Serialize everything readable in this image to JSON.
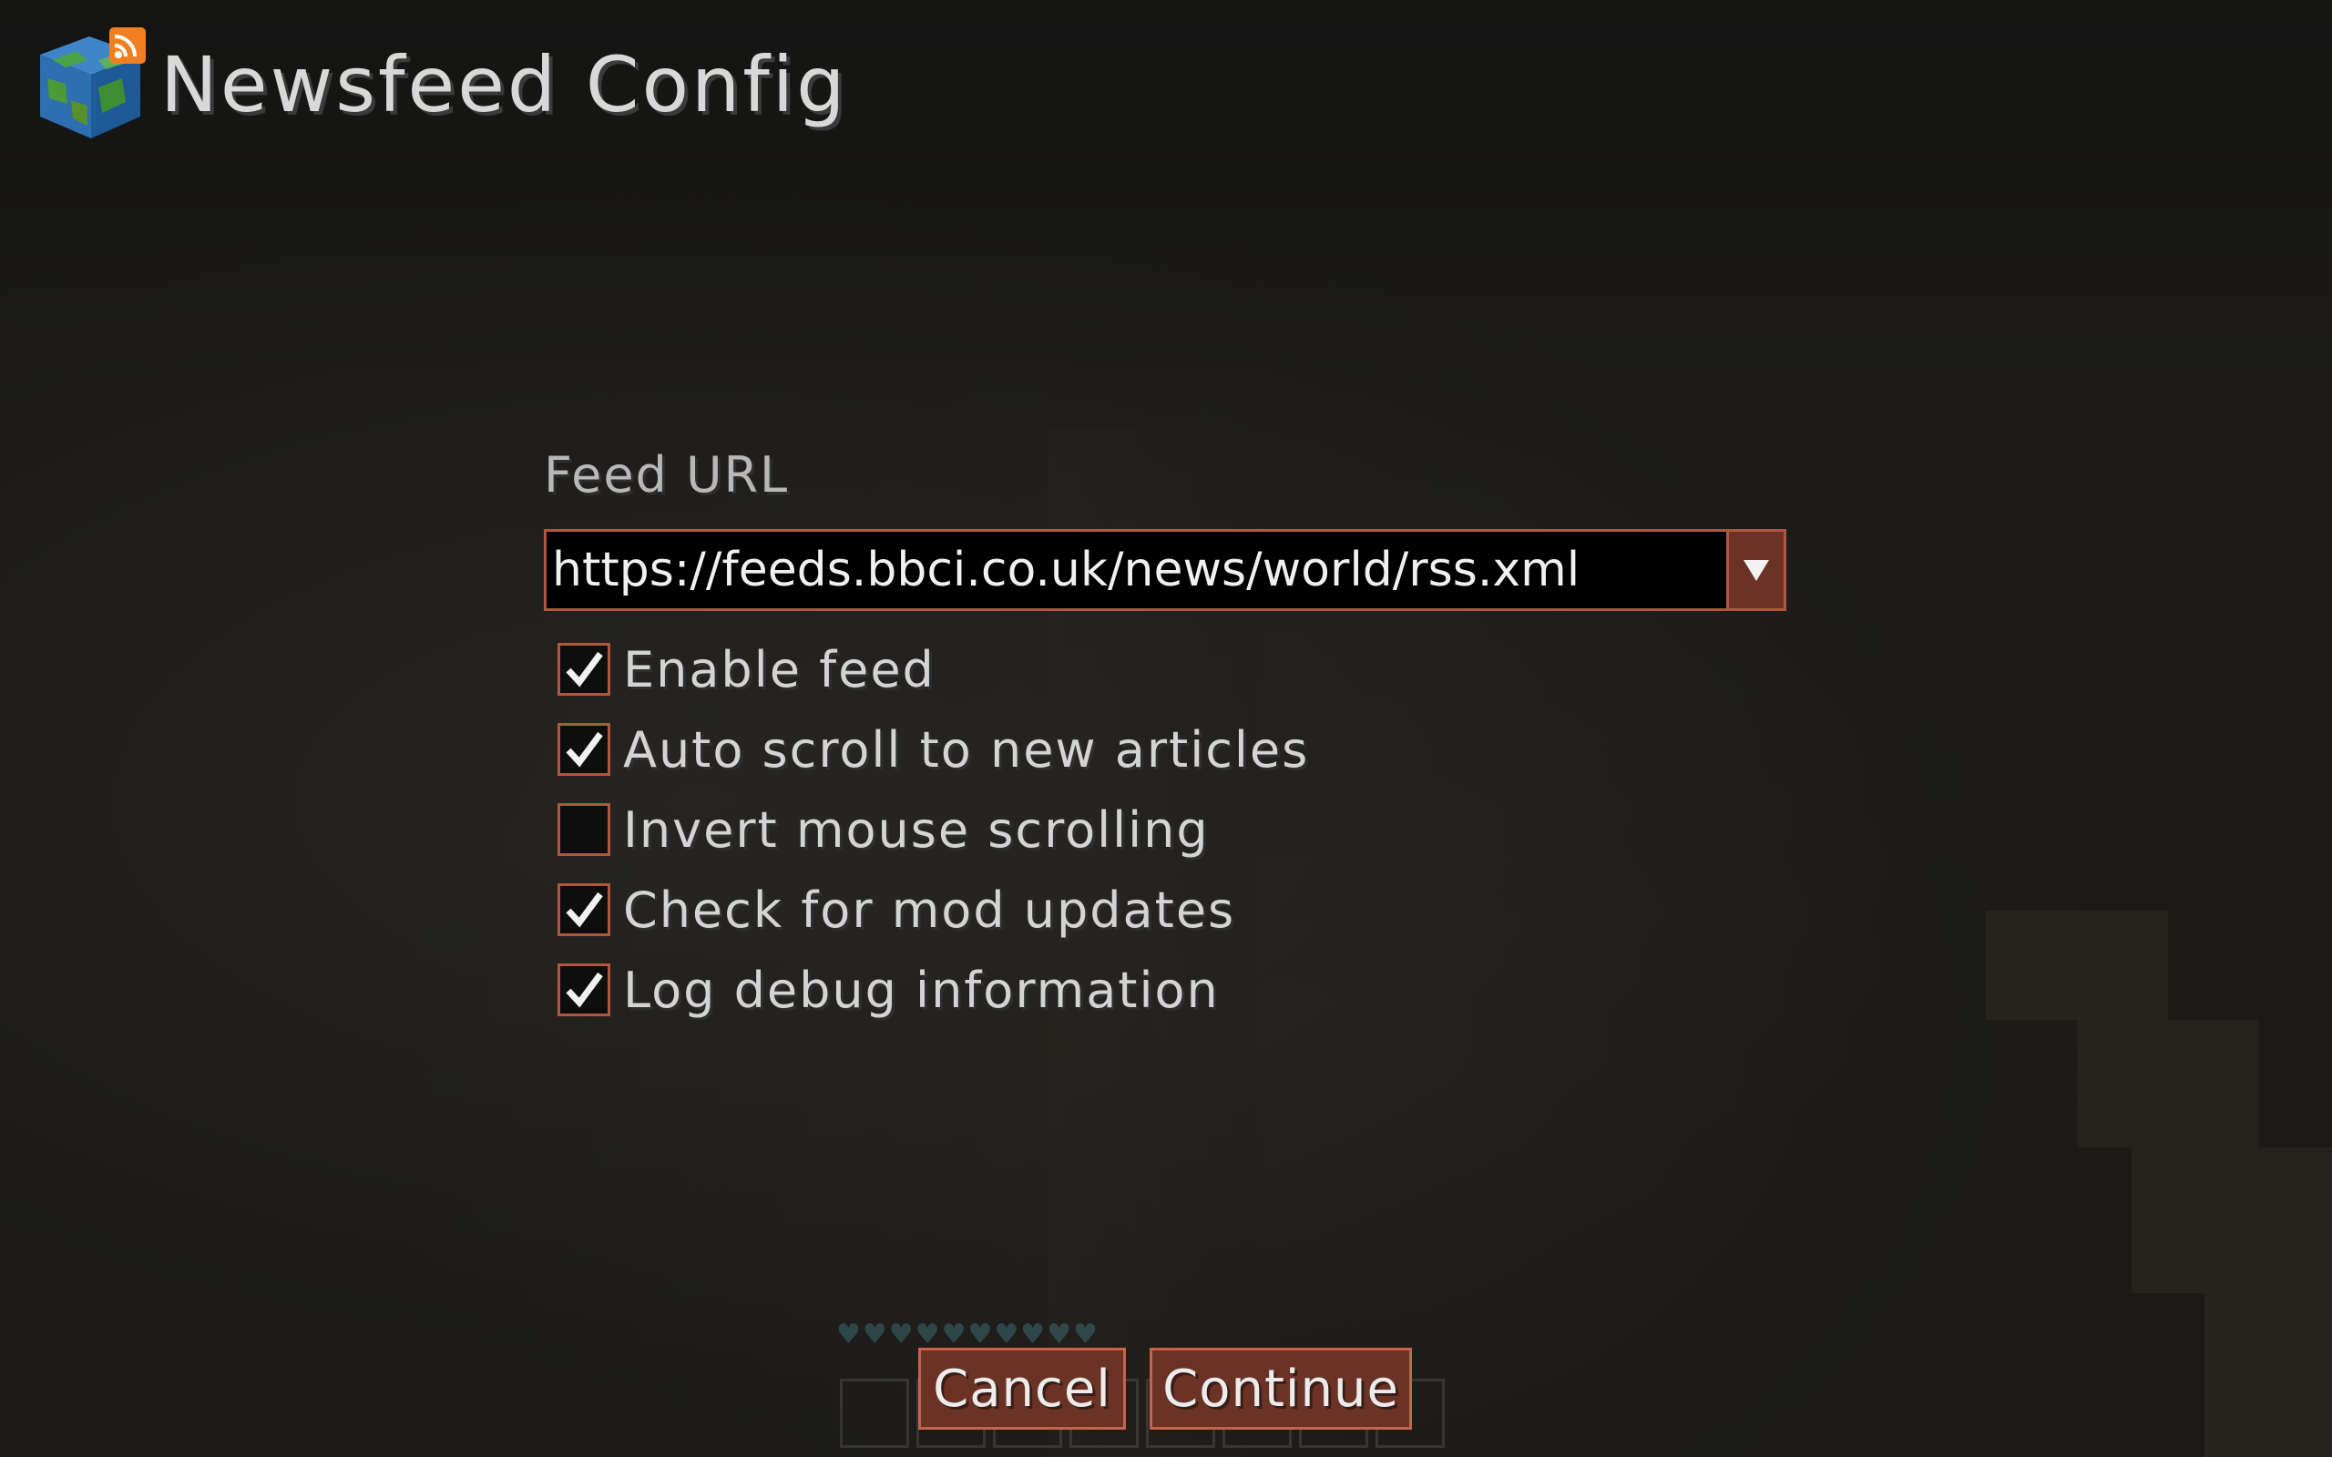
{
  "app": {
    "title": "Newsfeed Config",
    "logo_icon": "globe-rss-icon"
  },
  "feed": {
    "label": "Feed URL",
    "url_value": "https://feeds.bbci.co.uk/news/world/rss.xml",
    "dropdown_icon": "triangle-down-icon"
  },
  "options": [
    {
      "label": "Enable feed",
      "checked": true
    },
    {
      "label": "Auto scroll to new articles",
      "checked": true
    },
    {
      "label": "Invert mouse scrolling",
      "checked": false
    },
    {
      "label": "Check for mod updates",
      "checked": true
    },
    {
      "label": "Log debug information",
      "checked": true
    }
  ],
  "buttons": {
    "cancel_label": "Cancel",
    "continue_label": "Continue"
  },
  "colors": {
    "accent_border": "#b0583f",
    "button_fill": "#6a3326",
    "background": "#1b1a18"
  }
}
